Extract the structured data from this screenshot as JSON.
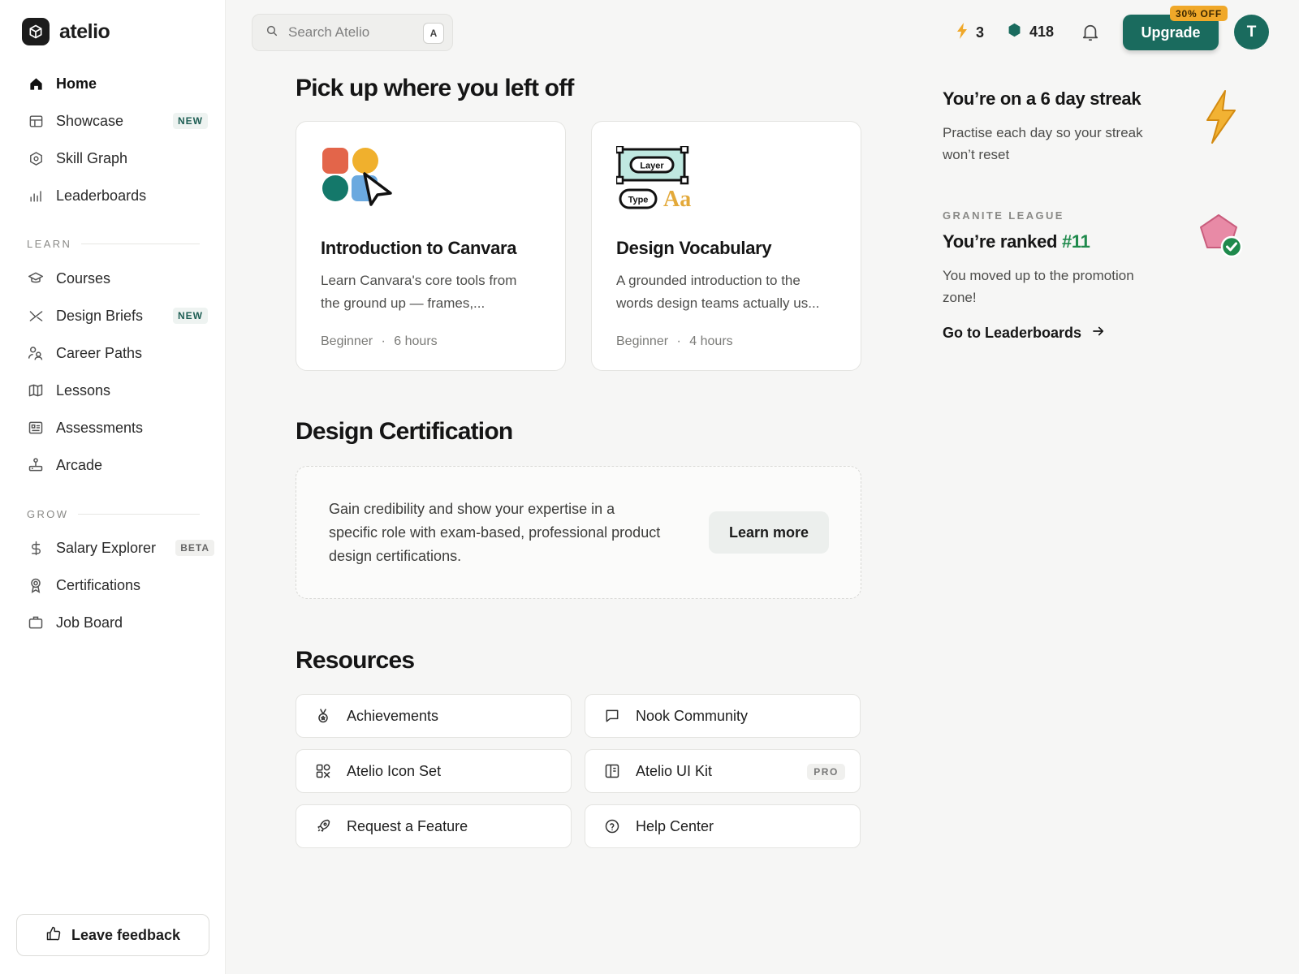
{
  "app": {
    "name": "atelio"
  },
  "sidebar": {
    "primary": [
      {
        "label": "Home",
        "icon": "home-icon"
      },
      {
        "label": "Showcase",
        "icon": "layout-icon",
        "badge": "NEW"
      },
      {
        "label": "Skill Graph",
        "icon": "hexagon-icon"
      },
      {
        "label": "Leaderboards",
        "icon": "bar-chart-icon"
      }
    ],
    "learn_label": "LEARN",
    "learn": [
      {
        "label": "Courses",
        "icon": "graduation-cap-icon"
      },
      {
        "label": "Design Briefs",
        "icon": "shuffle-icon",
        "badge": "NEW"
      },
      {
        "label": "Career Paths",
        "icon": "users-icon"
      },
      {
        "label": "Lessons",
        "icon": "map-icon"
      },
      {
        "label": "Assessments",
        "icon": "id-card-icon"
      },
      {
        "label": "Arcade",
        "icon": "joystick-icon"
      }
    ],
    "grow_label": "GROW",
    "grow": [
      {
        "label": "Salary Explorer",
        "icon": "dollar-icon",
        "badge": "BETA"
      },
      {
        "label": "Certifications",
        "icon": "award-icon"
      },
      {
        "label": "Job Board",
        "icon": "briefcase-icon"
      }
    ],
    "feedback_label": "Leave feedback"
  },
  "topbar": {
    "search_placeholder": "Search Atelio",
    "search_shortcut": "A",
    "streak_count": "3",
    "gems_count": "418",
    "upgrade_label": "Upgrade",
    "offer_label": "30% OFF",
    "avatar_initial": "T",
    "accent_color": "#1a6b5e"
  },
  "main": {
    "continue_title": "Pick up where you left off",
    "courses": [
      {
        "title": "Introduction to Canvara",
        "desc_line1": "Learn Canvara's core tools from",
        "desc_line2": "the ground up — frames,...",
        "level": "Beginner",
        "sep": "·",
        "duration": "6 hours"
      },
      {
        "title": "Design Vocabulary",
        "desc_line1": "A grounded introduction to the",
        "desc_line2": "words design teams actually us...",
        "level": "Beginner",
        "sep": "·",
        "duration": "4 hours",
        "art_layer": "Layer",
        "art_type": "Type",
        "art_aa": "Aa"
      }
    ],
    "cert_title": "Design Certification",
    "cert_text_line1": "Gain credibility and show your expertise in a",
    "cert_text_line2": "specific role with exam-based, professional product",
    "cert_text_line3": "design certifications.",
    "cert_button": "Learn more",
    "resources_title": "Resources",
    "resources": [
      {
        "label": "Achievements",
        "icon": "medal-icon"
      },
      {
        "label": "Nook Community",
        "icon": "chat-bubble-icon"
      },
      {
        "label": "Atelio Icon Set",
        "icon": "shapes-icon"
      },
      {
        "label": "Atelio UI Kit",
        "icon": "book-icon",
        "badge": "PRO"
      },
      {
        "label": "Request a Feature",
        "icon": "rocket-icon"
      },
      {
        "label": "Help Center",
        "icon": "help-circle-icon"
      }
    ]
  },
  "right": {
    "streak_title": "You’re on a 6 day streak",
    "streak_desc_line1": "Practise each day so your streak",
    "streak_desc_line2": "won’t reset",
    "league_label": "GRANITE LEAGUE",
    "rank_prefix": "You’re ranked ",
    "rank_value": "#11",
    "rank_desc_line1": "You moved up to the promotion",
    "rank_desc_line2": "zone!",
    "leaderboards_link": "Go to Leaderboards"
  }
}
